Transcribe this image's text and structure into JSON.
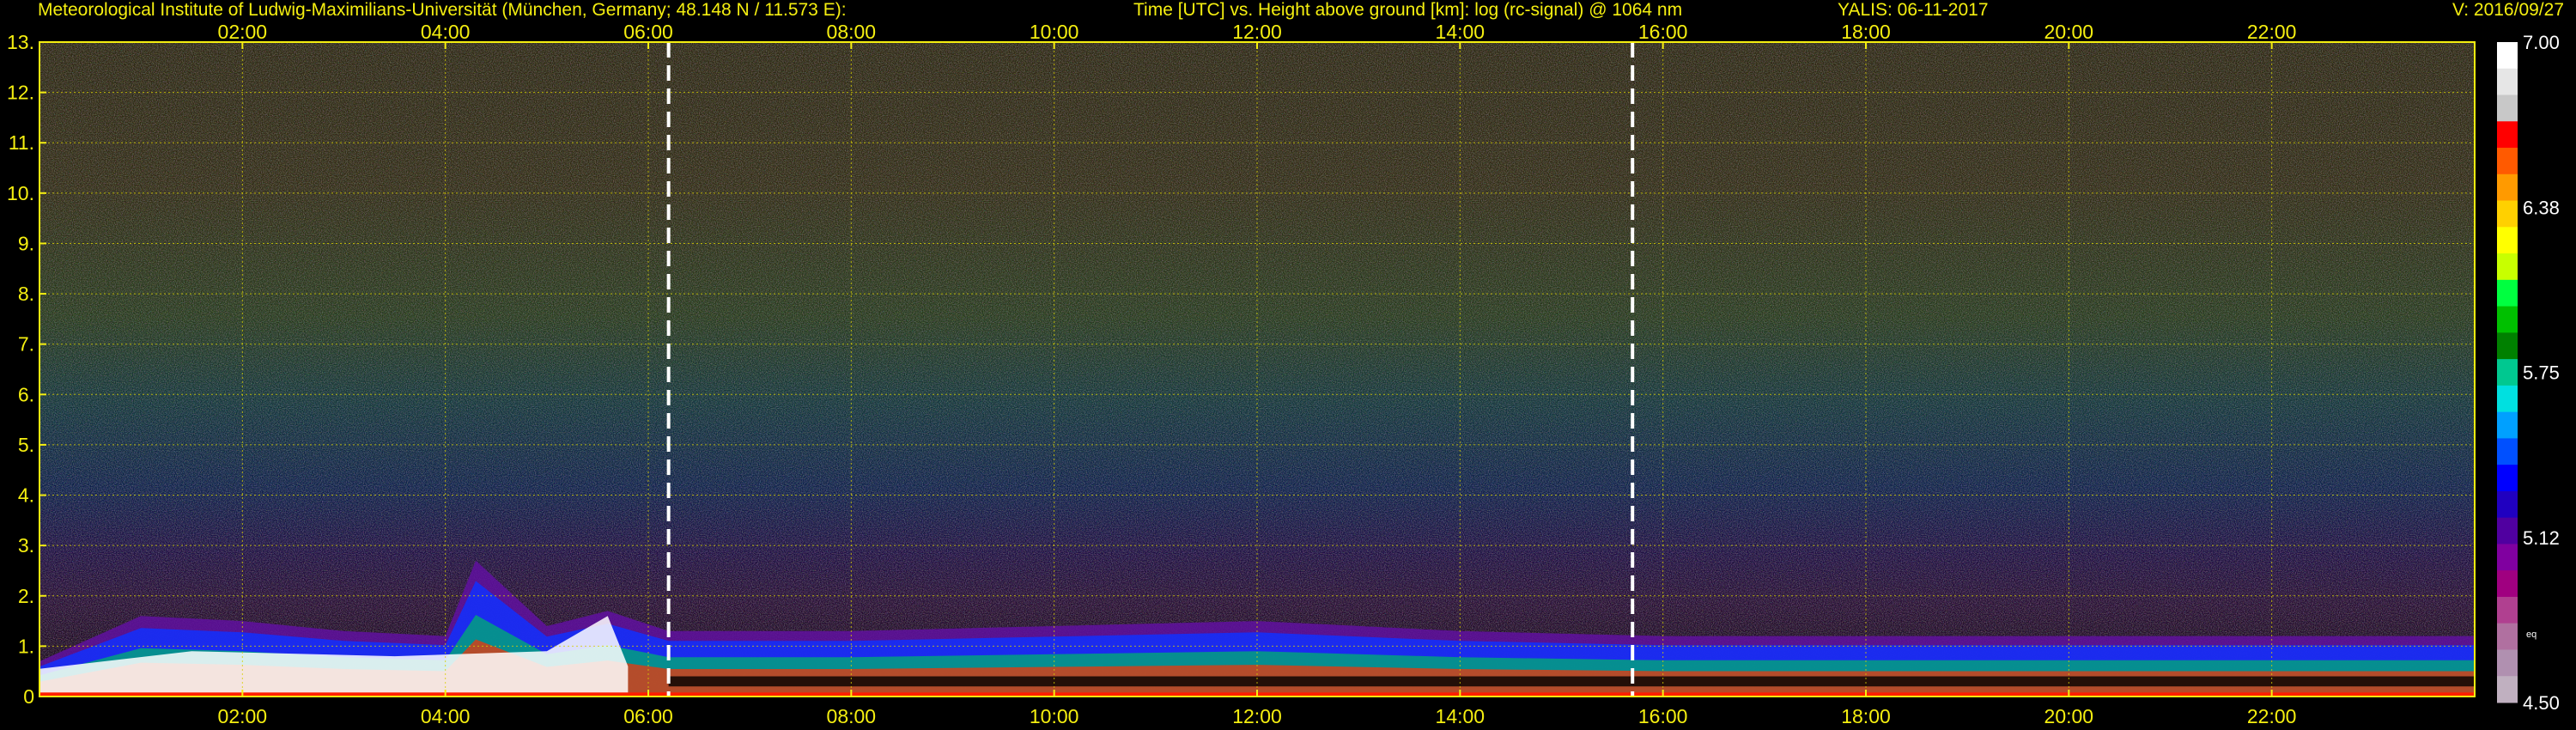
{
  "header": {
    "institute": "Meteorological Institute of Ludwig-Maximilians-Universität (München, Germany; 48.148 N / 11.573 E):",
    "axes_description": "Time [UTC] vs. Height above ground [km]: log (rc-signal) @ 1064 nm",
    "instrument_date": "YALIS: 06-11-2017",
    "version": "V: 2016/09/27"
  },
  "chart_data": {
    "type": "heatmap",
    "title": "Time [UTC] vs. Height above ground [km]: log (rc-signal) @ 1064 nm",
    "xlabel": "Time [UTC]",
    "ylabel": "Height above ground [km]",
    "xlim": [
      0,
      24
    ],
    "ylim": [
      0,
      13
    ],
    "x_ticks": [
      "02:00",
      "04:00",
      "06:00",
      "08:00",
      "10:00",
      "12:00",
      "14:00",
      "16:00",
      "18:00",
      "20:00",
      "22:00"
    ],
    "x_tick_hours": [
      2,
      4,
      6,
      8,
      10,
      12,
      14,
      16,
      18,
      20,
      22
    ],
    "y_ticks": [
      0,
      1,
      2,
      3,
      4,
      5,
      6,
      7,
      8,
      9,
      10,
      11,
      12,
      13
    ],
    "grid": true,
    "vertical_markers_hours": [
      6.2,
      15.7
    ],
    "colorbar": {
      "min": 4.5,
      "max": 7.0,
      "labels": [
        "7.00",
        "6.38",
        "5.75",
        "5.12",
        "4.50"
      ],
      "note": "eq",
      "colors": [
        "#ffffff",
        "#e6e6e6",
        "#c8c8c8",
        "#ff0000",
        "#ff5a00",
        "#ff9a00",
        "#ffd000",
        "#ffff00",
        "#c8ff00",
        "#00ff40",
        "#00c000",
        "#008000",
        "#00c890",
        "#00e0e0",
        "#00a0ff",
        "#0050ff",
        "#0000ff",
        "#2000c0",
        "#5000a0",
        "#8000a0",
        "#a00080",
        "#b04090",
        "#b070a0",
        "#b090b0",
        "#c0b0c0"
      ]
    },
    "boundary_layer_top_km": [
      {
        "hour": 0.0,
        "height": 0.7
      },
      {
        "hour": 1.0,
        "height": 1.6
      },
      {
        "hour": 2.0,
        "height": 1.5
      },
      {
        "hour": 3.0,
        "height": 1.3
      },
      {
        "hour": 4.0,
        "height": 1.2
      },
      {
        "hour": 4.3,
        "height": 2.7
      },
      {
        "hour": 5.0,
        "height": 1.4
      },
      {
        "hour": 5.6,
        "height": 1.7
      },
      {
        "hour": 6.2,
        "height": 1.3
      },
      {
        "hour": 8.0,
        "height": 1.3
      },
      {
        "hour": 10.0,
        "height": 1.4
      },
      {
        "hour": 12.0,
        "height": 1.5
      },
      {
        "hour": 14.0,
        "height": 1.3
      },
      {
        "hour": 16.0,
        "height": 1.2
      },
      {
        "hour": 18.0,
        "height": 1.2
      },
      {
        "hour": 20.0,
        "height": 1.2
      },
      {
        "hour": 22.0,
        "height": 1.2
      },
      {
        "hour": 24.0,
        "height": 1.2
      }
    ]
  }
}
